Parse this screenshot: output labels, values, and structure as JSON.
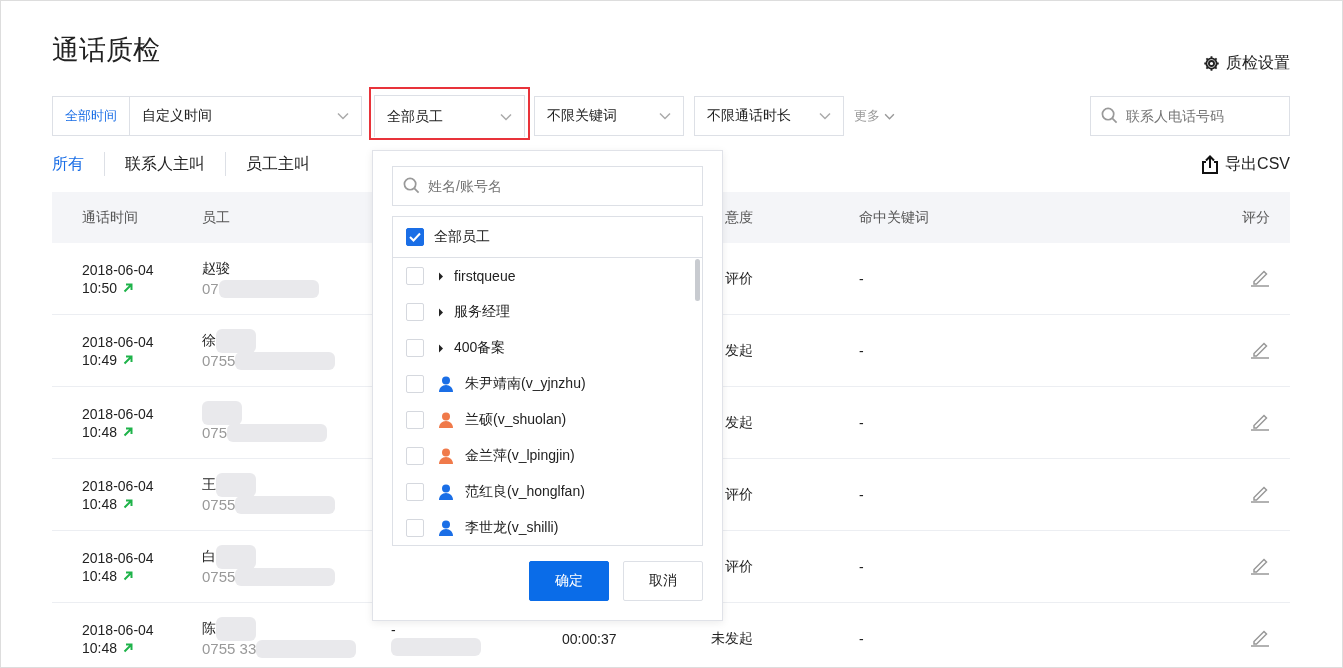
{
  "title": "通话质检",
  "settings_link": "质检设置",
  "filters": {
    "time_scope": "全部时间",
    "time_range": "自定义时间",
    "employee": "全部员工",
    "keyword": "不限关键词",
    "duration": "不限通话时长",
    "more": "更多",
    "search": {
      "placeholder": "联系人电话号码"
    }
  },
  "tabs": [
    {
      "label": "所有",
      "selected": true
    },
    {
      "label": "联系人主叫",
      "selected": false
    },
    {
      "label": "员工主叫",
      "selected": false
    }
  ],
  "export": "导出CSV",
  "table": {
    "columns": [
      {
        "label": "通话时间"
      },
      {
        "label": "员工"
      },
      {
        "label": "意度"
      },
      {
        "label": "命中关键词"
      },
      {
        "label": "评分"
      }
    ],
    "rows": [
      {
        "date": "2018-06-04",
        "time": "10:50",
        "employee": "赵骏",
        "name_masked": false,
        "phone": "07",
        "satisfaction": "评价",
        "keywords": "-"
      },
      {
        "date": "2018-06-04",
        "time": "10:49",
        "employee": "徐",
        "name_masked": true,
        "phone": "0755",
        "satisfaction": "发起",
        "keywords": "-"
      },
      {
        "date": "2018-06-04",
        "time": "10:48",
        "employee": "",
        "name_masked": true,
        "phone": "075",
        "satisfaction": "发起",
        "keywords": "-"
      },
      {
        "date": "2018-06-04",
        "time": "10:48",
        "employee": "王",
        "name_masked": true,
        "phone": "0755",
        "satisfaction": "评价",
        "keywords": "-"
      },
      {
        "date": "2018-06-04",
        "time": "10:48",
        "employee": "白",
        "name_masked": true,
        "phone": "0755",
        "satisfaction": "评价",
        "keywords": "-"
      },
      {
        "date": "2018-06-04",
        "time": "10:48",
        "employee": "陈",
        "name_masked": true,
        "phone": "0755 33",
        "column_3": "-",
        "duration": "00:00:37",
        "satisfaction": "未发起",
        "keywords": "-"
      }
    ]
  },
  "dropdown": {
    "search": {
      "placeholder": "姓名/账号名"
    },
    "all": {
      "label": "全部员工",
      "checked": true
    },
    "items": [
      {
        "kind": "group",
        "label": "firstqueue",
        "checked": false
      },
      {
        "kind": "group",
        "label": "服务经理",
        "checked": false
      },
      {
        "kind": "group",
        "label": "400备案",
        "checked": false
      },
      {
        "kind": "person",
        "label": "朱尹靖南(v_yjnzhu)",
        "checked": false,
        "color": "#1a6ee6"
      },
      {
        "kind": "person",
        "label": "兰硕(v_shuolan)",
        "checked": false,
        "color": "#f07a4a"
      },
      {
        "kind": "person",
        "label": "金兰萍(v_lpingjin)",
        "checked": false,
        "color": "#f07a4a"
      },
      {
        "kind": "person",
        "label": "范红良(v_honglfan)",
        "checked": false,
        "color": "#1a6ee6"
      },
      {
        "kind": "person",
        "label": "李世龙(v_shilli)",
        "checked": false,
        "color": "#1a6ee6"
      }
    ],
    "buttons": [
      "确定",
      "取消"
    ]
  }
}
